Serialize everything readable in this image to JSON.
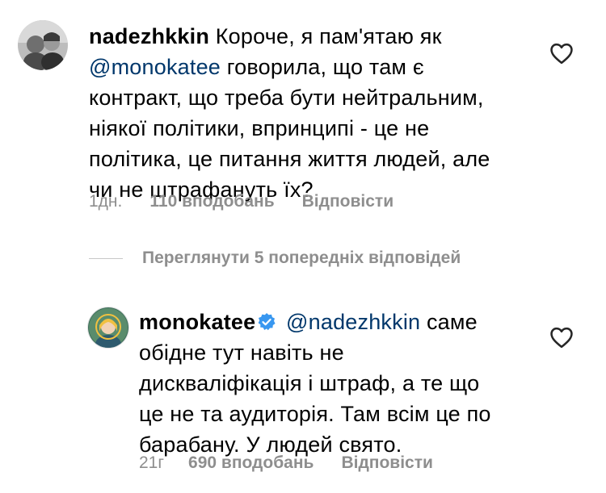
{
  "comments": [
    {
      "username": "nadezhkkin",
      "verified": false,
      "mention": "",
      "text_lines": [
        "Короче, я пам'ятаю як",
        "@monokatee говорила, що там є",
        "контракт, що треба бути нейтральним,",
        "ніякої політики, впринципі - це не",
        "політика, це питання життя людей, але",
        "чи не штрафануть їх?"
      ],
      "line1_rest": "Короче, я пам'ятаю як",
      "line2_mention": "@monokatee",
      "line2_rest": " говорила, що там є",
      "time": "1дн.",
      "likes": "110 вподобань",
      "reply_label": "Відповісти"
    },
    {
      "username": "monokatee",
      "verified": true,
      "mention": "@nadezhkkin",
      "line1_rest": " саме",
      "lines_rest": [
        "обідне тут навіть не",
        "дискваліфікація і штраф, а те що",
        "це не та аудиторія. Там всім це по",
        "барабану.  У людей свято."
      ],
      "time": "21г",
      "likes": "690 вподобань",
      "reply_label": "Відповісти"
    }
  ],
  "view_previous_replies": "Переглянути 5 попередніх відповідей",
  "colors": {
    "mention": "#00376b",
    "meta": "#8e8e8e",
    "verified": "#3897f0",
    "divider": "#c7c7c7"
  },
  "icons": [
    "heart-outline-icon",
    "verified-badge-icon"
  ]
}
